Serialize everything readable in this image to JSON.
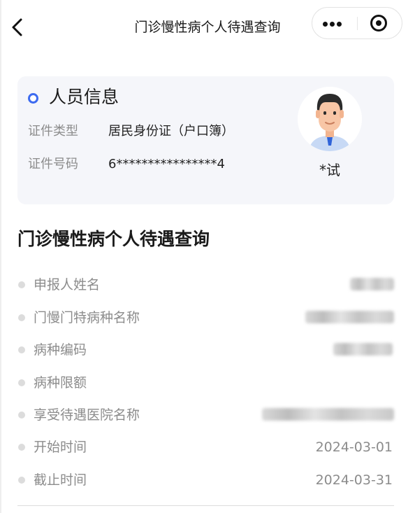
{
  "nav": {
    "title": "门诊慢性病个人待遇查询"
  },
  "person_card": {
    "title": "人员信息",
    "rows": [
      {
        "label": "证件类型",
        "value": "居民身份证（户口簿）"
      },
      {
        "label": "证件号码",
        "value": "6****************4"
      }
    ],
    "name": "*试"
  },
  "section": {
    "title": "门诊慢性病个人待遇查询",
    "items": [
      {
        "label": "申报人姓名",
        "value": ""
      },
      {
        "label": "门慢门特病种名称",
        "value": ""
      },
      {
        "label": "病种编码",
        "value": ""
      },
      {
        "label": "病种限额",
        "value": ""
      },
      {
        "label": "享受待遇医院名称",
        "value": ""
      },
      {
        "label": "开始时间",
        "value": "2024-03-01"
      },
      {
        "label": "截止时间",
        "value": "2024-03-31"
      }
    ]
  },
  "colors": {
    "accent": "#3d6bf0",
    "card_bg": "#f5f6fa",
    "label_gray": "#8c8c8c"
  }
}
